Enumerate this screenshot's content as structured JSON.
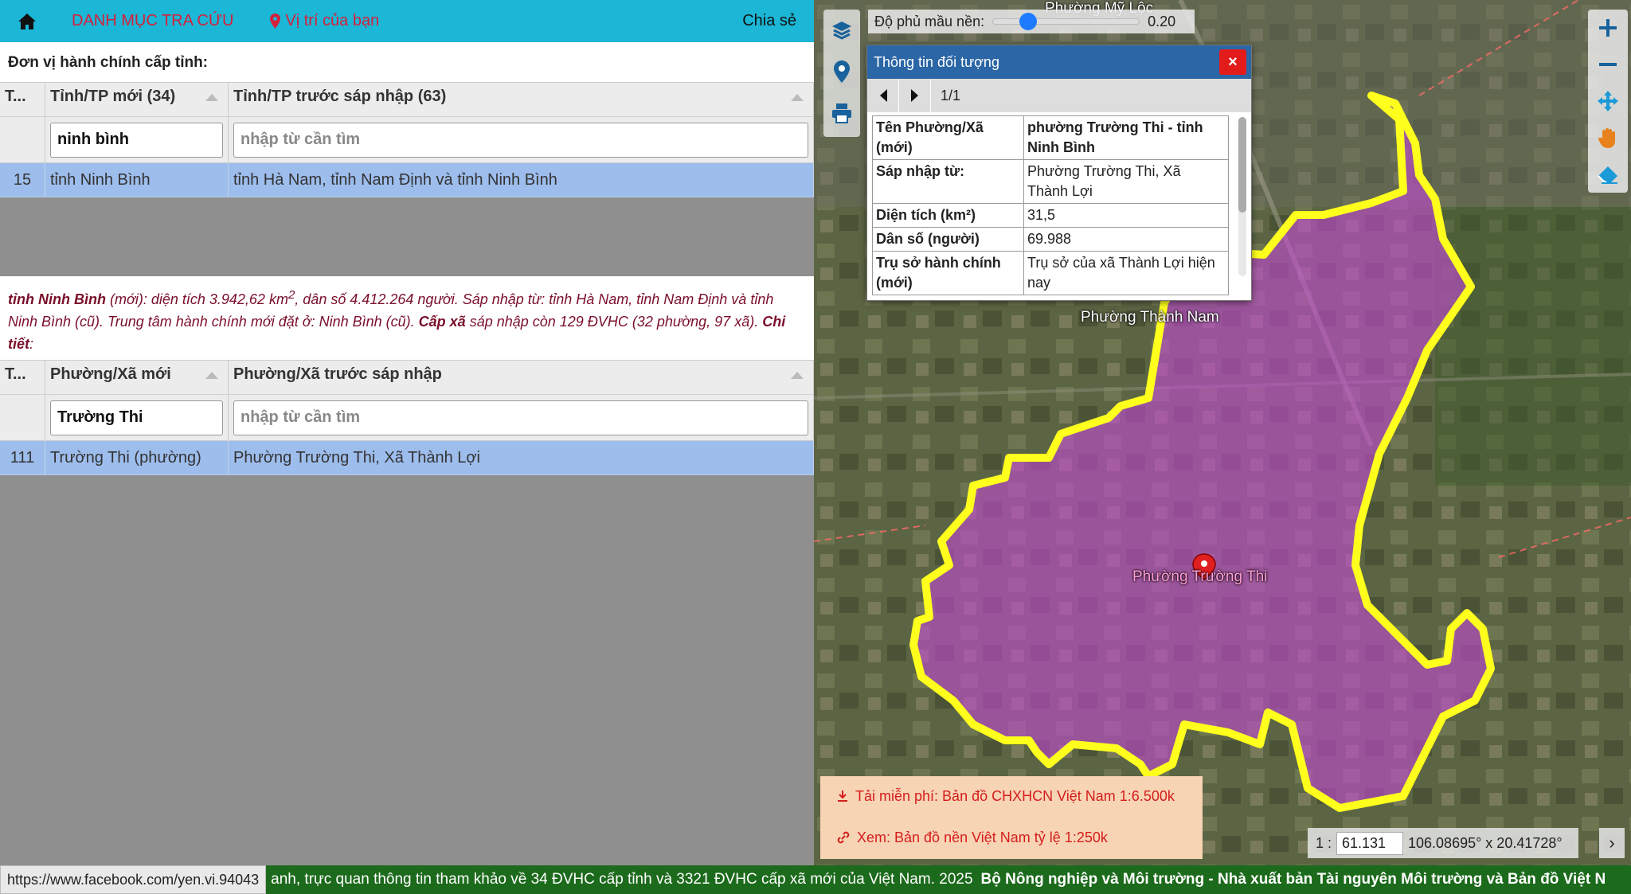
{
  "topbar": {
    "home_icon": "home-icon",
    "menu": "DANH MỤC TRA CỨU",
    "location": "Vị trí của bạn",
    "share": "Chia sẻ"
  },
  "province": {
    "section_title": "Đơn vị hành chính cấp tỉnh:",
    "headers": [
      "T...",
      "Tỉnh/TP mới (34)",
      "Tỉnh/TP trước sáp nhập (63)"
    ],
    "filter_new": "ninh bình",
    "filter_old_placeholder": "nhập từ cần tìm",
    "row": {
      "id": "15",
      "new": "tỉnh Ninh Bình",
      "old": "tỉnh Hà Nam, tỉnh Nam Định và tỉnh Ninh Bình"
    }
  },
  "info": {
    "name": "tỉnh Ninh Bình",
    "p1": " (mới): diện tích 3.942,62 km",
    "sup": "2",
    "p2": ", dân số 4.412.264 người. Sáp nhập từ: tỉnh Hà Nam, tỉnh Nam Định và tỉnh Ninh Bình (cũ). Trung tâm hành chính mới đặt ở: Ninh Bình (cũ). ",
    "cap": "Cấp xã",
    "p3": " sáp nhập còn 129 ĐVHC (32 phường, 97 xã). ",
    "detail": "Chi tiết",
    "colon": ":"
  },
  "ward": {
    "headers": [
      "T...",
      "Phường/Xã mới",
      "Phường/Xã trước sáp nhập"
    ],
    "filter_new": "Trường Thi",
    "filter_old_placeholder": "nhập từ cần tìm",
    "row": {
      "id": "111",
      "new": "Trường Thi (phường)",
      "old": "Phường Trường Thi, Xã Thành Lợi"
    }
  },
  "map": {
    "opacity_label": "Độ phủ mầu nền:",
    "opacity_value": "0.20",
    "opacity_level": 0.2,
    "popup": {
      "title": "Thông tin đối tượng",
      "close": "×",
      "counter": "1/1",
      "rows": [
        {
          "k": "Tên Phường/Xã (mới)",
          "v": "phường Trường Thi - tỉnh Ninh Bình"
        },
        {
          "k": "Sáp nhập từ:",
          "v": "Phường Trường Thi, Xã Thành Lợi"
        },
        {
          "k": "Diện tích (km²)",
          "v": "31,5"
        },
        {
          "k": "Dân số (người)",
          "v": "69.988"
        },
        {
          "k": "Trụ sở hành chính (mới)",
          "v": "Trụ sở của xã Thành Lợi hiện nay"
        }
      ]
    },
    "labels": {
      "top": "Phường Mỹ Lộc",
      "thanh_nam": "Phường Thành Nam",
      "truong_thi": "Phường Trường Thi"
    },
    "download": "Tải miễn phí: Bản đồ CHXHCN Việt Nam 1:6.500k",
    "view": "Xem: Bản đồ nền Việt Nam tỷ lệ 1:250k",
    "scale_prefix": "1 :",
    "scale_value": "61.131",
    "coords": "106.08695° x 20.41728°",
    "colors": {
      "polygon_fill": "#c24bd0",
      "polygon_stroke": "#ffff1e",
      "accent": "#1cb6d6"
    }
  },
  "footer": {
    "link": "https://www.facebook.com/yen.vi.94043",
    "text": "anh, trực quan thông tin tham khảo về 34 ĐVHC cấp tỉnh và 3321 ĐVHC cấp xã mới của Việt Nam. 2025",
    "publisher": "Bộ Nông nghiệp và Môi trường - Nhà xuất bản Tài nguyên Môi trường và Bản đồ Việt N"
  }
}
